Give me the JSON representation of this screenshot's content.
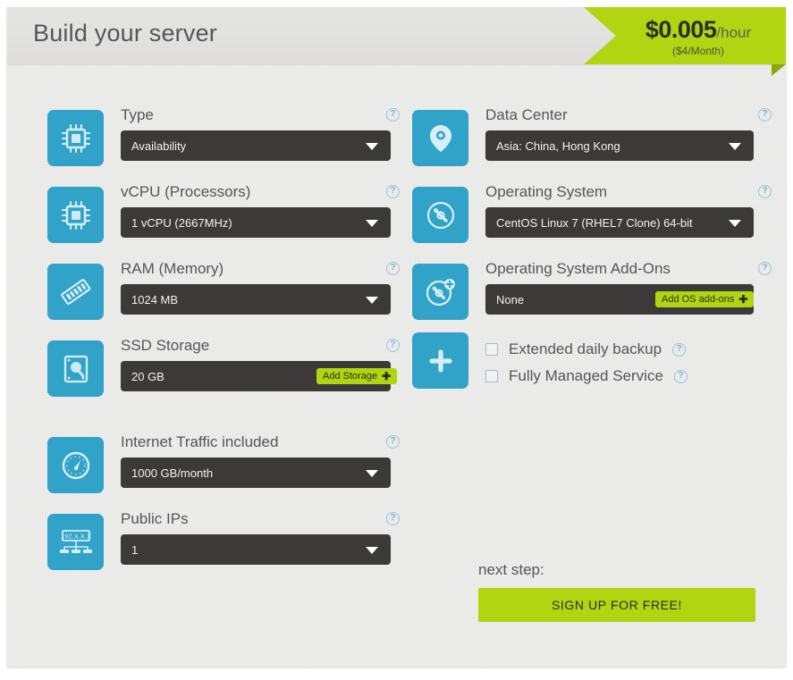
{
  "header": {
    "title": "Build your server",
    "price": {
      "amount": "$0.005",
      "unit": "/hour",
      "monthly": "($4/Month)"
    }
  },
  "colors": {
    "accent_blue": "#32a3c8",
    "accent_green": "#b2d411",
    "select_dark": "#3b3a38",
    "panel_bg": "#ececeb",
    "text_gray": "#55565a"
  },
  "left_column": [
    {
      "icon": "cpu-chip-icon",
      "label": "Type",
      "value": "Availability",
      "help": "?"
    },
    {
      "icon": "cpu-chip-icon",
      "label": "vCPU (Processors)",
      "value": "1 vCPU (2667MHz)",
      "help": "?"
    },
    {
      "icon": "memory-stick-icon",
      "label": "RAM (Memory)",
      "value": "1024 MB",
      "help": "?"
    },
    {
      "icon": "hard-drive-icon",
      "label": "SSD Storage",
      "value": "20 GB",
      "help": "?",
      "add_button": "Add Storage",
      "add_button_plus": "✚"
    },
    {
      "icon": "speedometer-icon",
      "label": "Internet Traffic included",
      "value": "1000 GB/month",
      "help": "?"
    },
    {
      "icon": "network-ip-icon",
      "label": "Public IPs",
      "value": "1",
      "help": "?",
      "icon_text": "192.X.X.X"
    }
  ],
  "right_column": [
    {
      "icon": "map-pin-icon",
      "label": "Data Center",
      "value": "Asia: China, Hong Kong",
      "help": "?"
    },
    {
      "icon": "disc-icon",
      "label": "Operating System",
      "value": "CentOS Linux 7 (RHEL7 Clone) 64-bit",
      "help": "?"
    },
    {
      "icon": "disc-plus-icon",
      "label": "Operating System Add-Ons",
      "value": "None",
      "help": "?",
      "add_button": "Add OS add-ons",
      "add_button_plus": "✚"
    }
  ],
  "addons": {
    "icon": "plus-icon",
    "options": [
      {
        "label": "Extended daily backup",
        "checked": false,
        "help": "?"
      },
      {
        "label": "Fully Managed Service",
        "checked": false,
        "help": "?"
      }
    ]
  },
  "next_step": {
    "label": "next step:",
    "button": "SIGN UP FOR FREE!"
  }
}
